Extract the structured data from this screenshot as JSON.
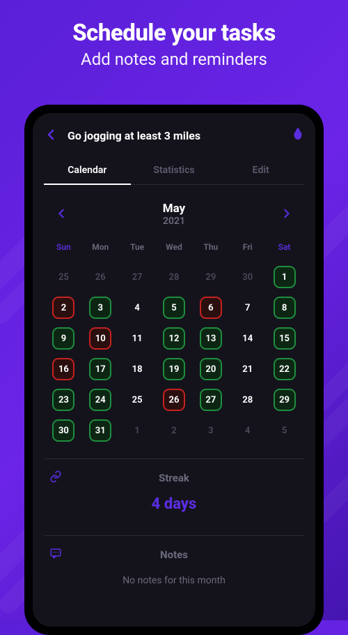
{
  "hero": {
    "title": "Schedule your tasks",
    "subtitle": "Add notes and reminders"
  },
  "header": {
    "task_title": "Go jogging at least 3 miles"
  },
  "tabs": {
    "calendar": "Calendar",
    "statistics": "Statistics",
    "edit": "Edit"
  },
  "month_nav": {
    "month": "May",
    "year": "2021"
  },
  "weekdays": [
    "Sun",
    "Mon",
    "Tue",
    "Wed",
    "Thu",
    "Fri",
    "Sat"
  ],
  "calendar_days": [
    [
      {
        "d": "25",
        "cls": "other-month"
      },
      {
        "d": "26",
        "cls": "other-month"
      },
      {
        "d": "27",
        "cls": "other-month"
      },
      {
        "d": "28",
        "cls": "other-month"
      },
      {
        "d": "29",
        "cls": "other-month"
      },
      {
        "d": "30",
        "cls": "other-month"
      },
      {
        "d": "1",
        "cls": "green"
      }
    ],
    [
      {
        "d": "2",
        "cls": "red"
      },
      {
        "d": "3",
        "cls": "green"
      },
      {
        "d": "4",
        "cls": ""
      },
      {
        "d": "5",
        "cls": "green"
      },
      {
        "d": "6",
        "cls": "red"
      },
      {
        "d": "7",
        "cls": ""
      },
      {
        "d": "8",
        "cls": "green"
      }
    ],
    [
      {
        "d": "9",
        "cls": "green"
      },
      {
        "d": "10",
        "cls": "red"
      },
      {
        "d": "11",
        "cls": ""
      },
      {
        "d": "12",
        "cls": "green"
      },
      {
        "d": "13",
        "cls": "green"
      },
      {
        "d": "14",
        "cls": ""
      },
      {
        "d": "15",
        "cls": "green"
      }
    ],
    [
      {
        "d": "16",
        "cls": "red"
      },
      {
        "d": "17",
        "cls": "green"
      },
      {
        "d": "18",
        "cls": ""
      },
      {
        "d": "19",
        "cls": "green"
      },
      {
        "d": "20",
        "cls": "green"
      },
      {
        "d": "21",
        "cls": ""
      },
      {
        "d": "22",
        "cls": "green"
      }
    ],
    [
      {
        "d": "23",
        "cls": "green"
      },
      {
        "d": "24",
        "cls": "green"
      },
      {
        "d": "25",
        "cls": ""
      },
      {
        "d": "26",
        "cls": "red"
      },
      {
        "d": "27",
        "cls": "green"
      },
      {
        "d": "28",
        "cls": ""
      },
      {
        "d": "29",
        "cls": "green"
      }
    ],
    [
      {
        "d": "30",
        "cls": "green"
      },
      {
        "d": "31",
        "cls": "green"
      },
      {
        "d": "1",
        "cls": "other-month"
      },
      {
        "d": "2",
        "cls": "other-month"
      },
      {
        "d": "3",
        "cls": "other-month"
      },
      {
        "d": "4",
        "cls": "other-month"
      },
      {
        "d": "5",
        "cls": "other-month"
      }
    ]
  ],
  "streak": {
    "label": "Streak",
    "value": "4 days"
  },
  "notes": {
    "label": "Notes",
    "empty": "No notes for this month"
  }
}
